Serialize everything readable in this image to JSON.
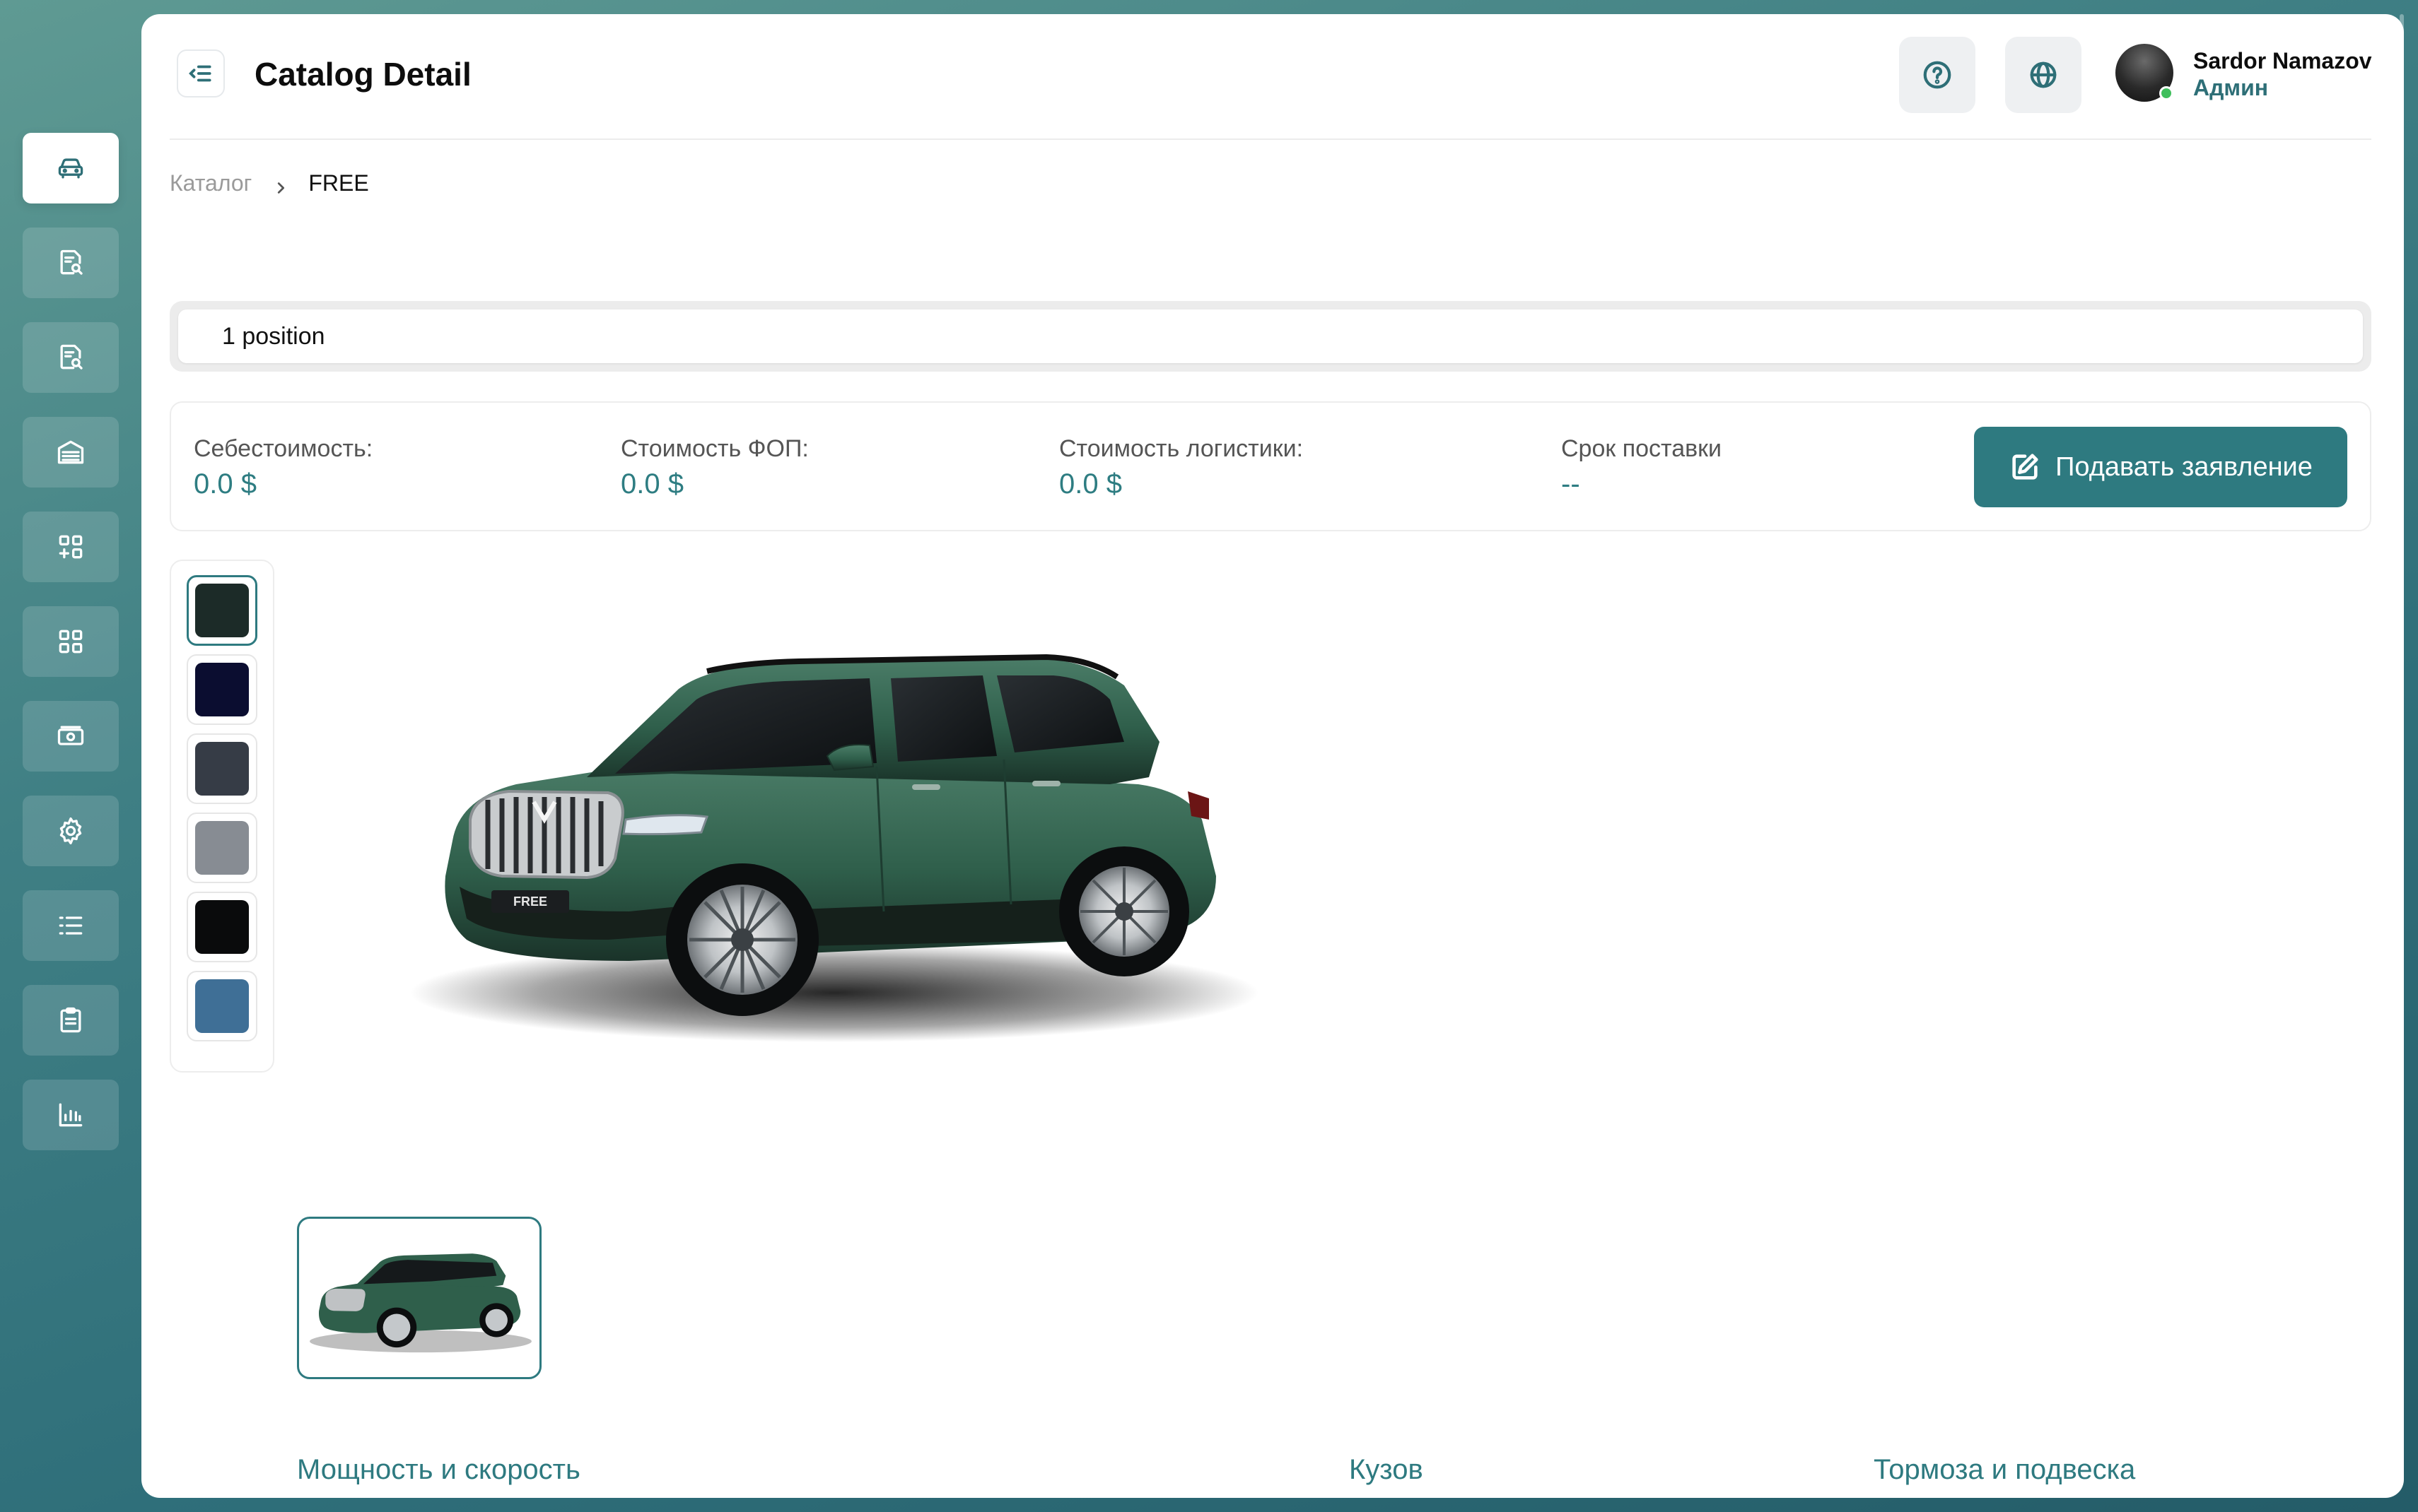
{
  "header": {
    "title": "Catalog Detail",
    "user": {
      "name": "Sardor Namazov",
      "role": "Админ",
      "online": true
    }
  },
  "sidebar": {
    "items": [
      {
        "icon": "car-icon",
        "active": true
      },
      {
        "icon": "document-search-icon",
        "active": false
      },
      {
        "icon": "document-search-icon",
        "active": false
      },
      {
        "icon": "warehouse-icon",
        "active": false
      },
      {
        "icon": "add-apps-icon",
        "active": false
      },
      {
        "icon": "apps-grid-icon",
        "active": false
      },
      {
        "icon": "money-icon",
        "active": false
      },
      {
        "icon": "gear-icon",
        "active": false
      },
      {
        "icon": "list-icon",
        "active": false
      },
      {
        "icon": "clipboard-icon",
        "active": false
      },
      {
        "icon": "bar-chart-icon",
        "active": false
      }
    ]
  },
  "breadcrumb": {
    "root": "Каталог",
    "current": "FREE"
  },
  "positions": {
    "active_label": "1 position"
  },
  "costs": {
    "cost_price": {
      "label": "Себестоимость:",
      "value": "0.0 $"
    },
    "fop_cost": {
      "label": "Стоимость ФОП:",
      "value": "0.0 $"
    },
    "logistics_cost": {
      "label": "Стоимость логистики:",
      "value": "0.0 $"
    },
    "delivery_time": {
      "label": "Срок поставки",
      "value": "--"
    },
    "apply_button": "Подавать заявление"
  },
  "colors": {
    "swatches": [
      "#1c2b28",
      "#0b0d30",
      "#363c46",
      "#878c93",
      "#0a0b0c",
      "#3f6f96"
    ],
    "selected_index": 0,
    "car_body": "#2f5f4b"
  },
  "car": {
    "plate_text": "FREE"
  },
  "spec_tabs": [
    "Мощность и скорость",
    "Кузов",
    "Тормоза и подвеска"
  ],
  "theme": {
    "accent": "#2e7a80",
    "sidebar_gradient_top": "#5f9a93",
    "sidebar_gradient_bottom": "#245c68"
  }
}
